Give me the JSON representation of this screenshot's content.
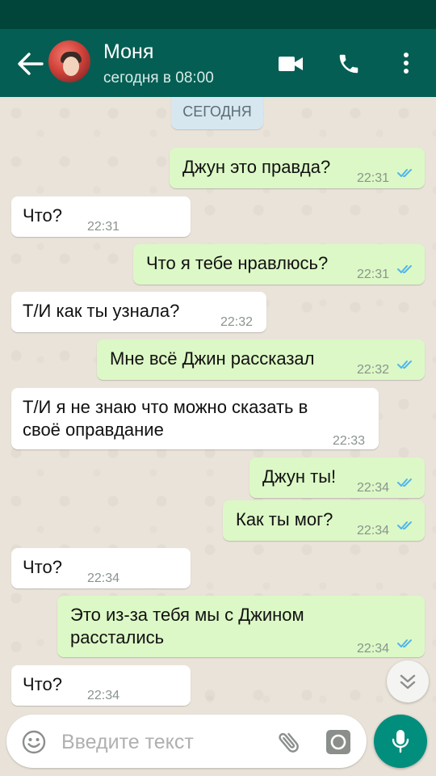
{
  "header": {
    "contact_name": "Моня",
    "contact_status": "сегодня в 08:00"
  },
  "chat": {
    "date_label": "СЕГОДНЯ",
    "messages": [
      {
        "dir": "out",
        "text": "Джун это правда?",
        "time": "22:31"
      },
      {
        "dir": "in",
        "text": "Что?",
        "time": "22:31"
      },
      {
        "dir": "out",
        "text": "Что я тебе нравлюсь?",
        "time": "22:31"
      },
      {
        "dir": "in",
        "text": "Т/И как ты узнала?",
        "time": "22:32"
      },
      {
        "dir": "out",
        "text": "Мне всё Джин рассказал",
        "time": "22:32"
      },
      {
        "dir": "in",
        "line1": "Т/И я не знаю что можно сказать в",
        "line2": "своё оправдание",
        "time": "22:33"
      },
      {
        "dir": "out",
        "text": "Джун ты!",
        "time": "22:34"
      },
      {
        "dir": "out",
        "text": "Как ты мог?",
        "time": "22:34"
      },
      {
        "dir": "in",
        "text": "Что?",
        "time": "22:34"
      },
      {
        "dir": "out",
        "line1": "Это из-за тебя мы с Джином",
        "line2": "расстались",
        "time": "22:34"
      },
      {
        "dir": "in",
        "text": "Что?",
        "time": "22:34"
      }
    ]
  },
  "composer": {
    "placeholder": "Введите текст"
  },
  "colors": {
    "header": "#055e54",
    "statusbar": "#00443a",
    "outgoing_bubble": "#dcf8c6",
    "incoming_bubble": "#ffffff",
    "read_ticks": "#4fb6ec",
    "mic_button": "#028e7d"
  },
  "icons": [
    "back-arrow-icon",
    "video-call-icon",
    "phone-icon",
    "more-vert-icon",
    "double-check-icon",
    "chevron-double-down-icon",
    "emoji-icon",
    "attach-icon",
    "camera-icon",
    "mic-icon"
  ]
}
